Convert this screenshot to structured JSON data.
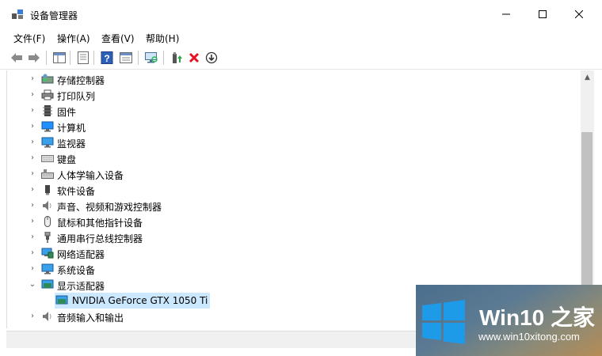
{
  "window": {
    "title": "设备管理器",
    "controls": {
      "minimize": "—",
      "maximize": "☐",
      "close": "✕"
    }
  },
  "menu": [
    "文件(F)",
    "操作(A)",
    "查看(V)",
    "帮助(H)"
  ],
  "toolbar": {
    "icons": [
      "back-arrow-icon",
      "forward-arrow-icon",
      "show-hide-tree-icon",
      "properties-icon",
      "help-icon",
      "view-icon",
      "scan-hardware-icon",
      "update-driver-icon",
      "uninstall-icon",
      "disable-device-icon"
    ]
  },
  "tree": {
    "items": [
      {
        "label": "存储控制器",
        "icon": "storage-controller-icon",
        "expanded": false
      },
      {
        "label": "打印队列",
        "icon": "printer-icon",
        "expanded": false
      },
      {
        "label": "固件",
        "icon": "firmware-icon",
        "expanded": false
      },
      {
        "label": "计算机",
        "icon": "computer-icon",
        "expanded": false
      },
      {
        "label": "监视器",
        "icon": "monitor-icon",
        "expanded": false
      },
      {
        "label": "键盘",
        "icon": "keyboard-icon",
        "expanded": false
      },
      {
        "label": "人体学输入设备",
        "icon": "hid-icon",
        "expanded": false
      },
      {
        "label": "软件设备",
        "icon": "software-device-icon",
        "expanded": false
      },
      {
        "label": "声音、视频和游戏控制器",
        "icon": "speaker-icon",
        "expanded": false
      },
      {
        "label": "鼠标和其他指针设备",
        "icon": "mouse-icon",
        "expanded": false
      },
      {
        "label": "通用串行总线控制器",
        "icon": "usb-icon",
        "expanded": false
      },
      {
        "label": "网络适配器",
        "icon": "network-adapter-icon",
        "expanded": false
      },
      {
        "label": "系统设备",
        "icon": "system-device-icon",
        "expanded": false
      },
      {
        "label": "显示适配器",
        "icon": "display-adapter-icon",
        "expanded": true
      },
      {
        "label": "NVIDIA GeForce GTX 1050 Ti",
        "icon": "display-adapter-icon",
        "child": true,
        "selected": true
      },
      {
        "label": "音频输入和输出",
        "icon": "audio-io-icon",
        "expanded": false
      }
    ]
  },
  "watermark": {
    "brand": "Win10 之家",
    "url": "www.win10xitong.com",
    "colors": {
      "logo": "#1e9be8",
      "text": "#ffffff"
    }
  },
  "colors": {
    "selection": "#cce8ff",
    "scrollbar_thumb": "#c1c1c1",
    "uninstall_red": "#e81123"
  }
}
